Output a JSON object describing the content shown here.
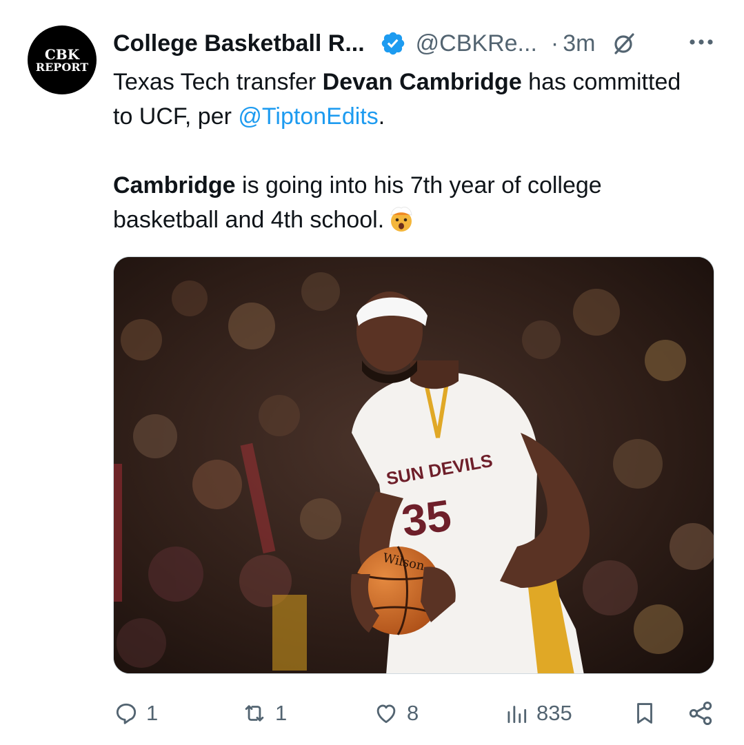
{
  "account": {
    "avatar_text_line1": "CBK",
    "avatar_text_line2": "REPORT",
    "display_name": "College Basketball R...",
    "handle": "@CBKRe...",
    "separator": "·",
    "time": "3m",
    "verified_icon": "verified-badge-icon",
    "brand_color": "#1d9bf0"
  },
  "tweet": {
    "p1_a": "Texas Tech transfer ",
    "p1_bold": "Devan Cambridge",
    "p1_b": " has committed to UCF, per ",
    "p1_mention": "@TiptonEdits",
    "p1_c": ".",
    "p2_bold": "Cambridge",
    "p2_a": " is going into his 7th year of college basketball and 4th school.",
    "emoji": "exploding-head-emoji"
  },
  "media": {
    "jersey_text": "SUN DEVILS",
    "jersey_number": "35",
    "ball_brand": "Wilson"
  },
  "actions": {
    "replies": "1",
    "reposts": "1",
    "likes": "8",
    "views": "835"
  }
}
